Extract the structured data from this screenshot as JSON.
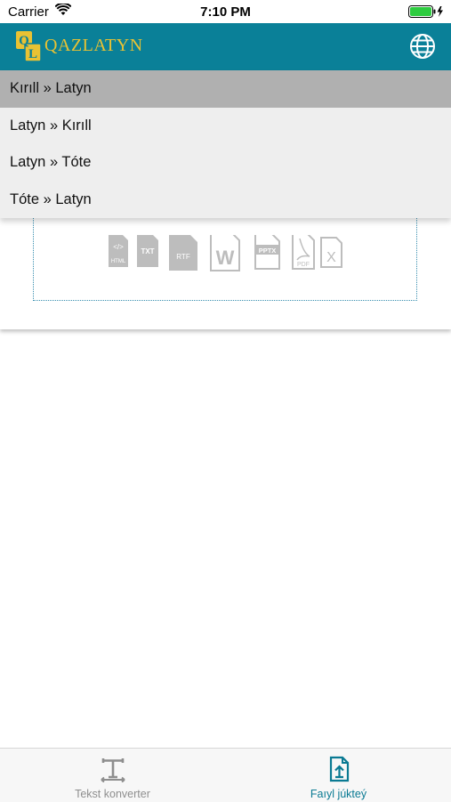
{
  "status_bar": {
    "carrier": "Carrier",
    "time": "7:10 PM"
  },
  "header": {
    "brand": "QAZLATYN",
    "logo_letters": [
      "Q",
      "L"
    ]
  },
  "menu": {
    "items": [
      {
        "label": "Kırıll » Latyn",
        "selected": true
      },
      {
        "label": "Latyn » Kırıll",
        "selected": false
      },
      {
        "label": "Latyn » Tóte",
        "selected": false
      },
      {
        "label": "Tóte » Latyn",
        "selected": false
      }
    ]
  },
  "upload": {
    "file_types": [
      "HTML",
      "TXT",
      "RTF",
      "W",
      "PPTX",
      "PDF",
      "X"
    ]
  },
  "tab_bar": {
    "tabs": [
      {
        "label": "Tekst konverter",
        "icon": "text-cursor-icon",
        "active": false
      },
      {
        "label": "Faıyl júkteý",
        "icon": "file-upload-icon",
        "active": true
      }
    ]
  },
  "colors": {
    "header_bg": "#0a8098",
    "brand": "#e9c233",
    "menu_bg": "#eeeeee",
    "menu_selected": "#b0b0b0",
    "active_tab": "#0a7a93",
    "inactive_tab": "#8e8e8e"
  }
}
